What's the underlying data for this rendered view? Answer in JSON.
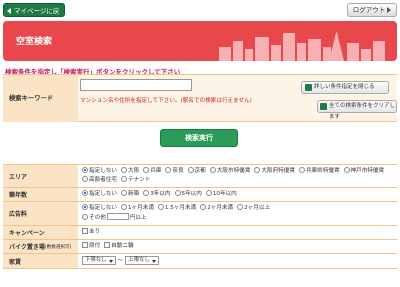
{
  "topbar": {
    "mypage_label": "マイページに戻る",
    "logout_label": "ログアウト"
  },
  "banner": {
    "title": "空室検索"
  },
  "instruction": "検索条件を指定し「検索実行」ボタンをクリックして下さい",
  "keyword": {
    "label": "検索キーワード",
    "value": "",
    "placeholder": "",
    "note": "マンション名や住所を指定して下さい。(駅名での検索は行えません)",
    "close_conditions_label": "詳しい条件指定を閉じる",
    "clear_all_label": "全ての検索条件をクリアします"
  },
  "execute_label": "検索実行",
  "rows": [
    {
      "label": "エリア",
      "type": "radio",
      "options": [
        {
          "text": "指定しない",
          "on": true
        },
        {
          "text": "大阪",
          "on": false
        },
        {
          "text": "兵庫",
          "on": false
        },
        {
          "text": "奈良",
          "on": false
        },
        {
          "text": "京都",
          "on": false
        },
        {
          "text": "大阪市特優賃",
          "on": false
        },
        {
          "text": "大阪府特優賃",
          "on": false
        },
        {
          "text": "兵庫県特優賃",
          "on": false
        },
        {
          "text": "神戸市特優賃",
          "on": false
        },
        {
          "text": "高齢者住宅",
          "on": false
        },
        {
          "text": "テナント",
          "on": false
        }
      ]
    },
    {
      "label": "築年数",
      "type": "radio",
      "options": [
        {
          "text": "指定しない",
          "on": true
        },
        {
          "text": "新築",
          "on": false
        },
        {
          "text": "3年以内",
          "on": false
        },
        {
          "text": "5年以内",
          "on": false
        },
        {
          "text": "10年以内",
          "on": false
        }
      ]
    },
    {
      "label": "広告料",
      "type": "radio",
      "options": [
        {
          "text": "指定しない",
          "on": true
        },
        {
          "text": "1ヶ月未満",
          "on": false
        },
        {
          "text": "1.5ヶ月未満",
          "on": false
        },
        {
          "text": "2ヶ月未満",
          "on": false
        },
        {
          "text": "2ヶ月以上",
          "on": false
        }
      ],
      "other": {
        "text": "その他",
        "suffix": "円以上"
      }
    },
    {
      "label": "キャンペーン",
      "type": "check",
      "options": [
        {
          "text": "あり",
          "on": false
        }
      ]
    },
    {
      "label": "バイク置き場",
      "label_note": "(敷数選択可)",
      "type": "check",
      "options": [
        {
          "text": "原付",
          "on": false
        },
        {
          "text": "自動二輪",
          "on": false
        }
      ]
    },
    {
      "label": "家賃",
      "type": "range",
      "from": "下限なし",
      "sep": "〜",
      "to": "上限なし"
    }
  ]
}
